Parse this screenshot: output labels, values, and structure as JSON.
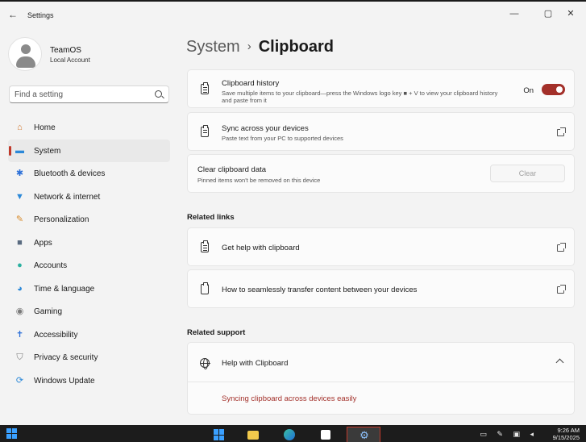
{
  "window": {
    "app_title": "Settings",
    "controls": {
      "minimize": "—",
      "maximize": "▢",
      "close": "✕"
    }
  },
  "profile": {
    "name": "TeamOS",
    "account_type": "Local Account"
  },
  "search": {
    "placeholder": "Find a setting"
  },
  "nav": {
    "items": [
      {
        "label": "Home",
        "icon": "home-icon",
        "glyph": "⌂",
        "color": "#d0762b",
        "active": false
      },
      {
        "label": "System",
        "icon": "system-icon",
        "glyph": "▬",
        "color": "#2b88d8",
        "active": true
      },
      {
        "label": "Bluetooth & devices",
        "icon": "bluetooth-icon",
        "glyph": "✱",
        "color": "#2b6fd8",
        "active": false
      },
      {
        "label": "Network & internet",
        "icon": "wifi-icon",
        "glyph": "▼",
        "color": "#2b88d8",
        "active": false
      },
      {
        "label": "Personalization",
        "icon": "brush-icon",
        "glyph": "✎",
        "color": "#d88a2b",
        "active": false
      },
      {
        "label": "Apps",
        "icon": "apps-icon",
        "glyph": "■",
        "color": "#5a6b80",
        "active": false
      },
      {
        "label": "Accounts",
        "icon": "accounts-icon",
        "glyph": "●",
        "color": "#2bb0a0",
        "active": false
      },
      {
        "label": "Time & language",
        "icon": "globe-clock-icon",
        "glyph": "◕",
        "color": "#2b88d8",
        "active": false
      },
      {
        "label": "Gaming",
        "icon": "gamepad-icon",
        "glyph": "◉",
        "color": "#7a7a7a",
        "active": false
      },
      {
        "label": "Accessibility",
        "icon": "accessibility-icon",
        "glyph": "✝",
        "color": "#2b6fd8",
        "active": false
      },
      {
        "label": "Privacy & security",
        "icon": "shield-icon",
        "glyph": "⛉",
        "color": "#7a7a7a",
        "active": false
      },
      {
        "label": "Windows Update",
        "icon": "update-icon",
        "glyph": "⟳",
        "color": "#2b88d8",
        "active": false
      }
    ]
  },
  "header": {
    "parent": "System",
    "separator": "›",
    "current": "Clipboard"
  },
  "clipboard_history": {
    "title": "Clipboard history",
    "description": "Save multiple items to your clipboard—press the Windows logo key ■ + V to view your clipboard history and paste from it",
    "state_label": "On",
    "enabled": true
  },
  "sync": {
    "title": "Sync across your devices",
    "description": "Paste text from your PC to supported devices"
  },
  "clear": {
    "title": "Clear clipboard data",
    "description": "Pinned items won't be removed on this device",
    "button_label": "Clear"
  },
  "related_links": {
    "heading": "Related links",
    "items": [
      {
        "label": "Get help with clipboard"
      },
      {
        "label": "How to seamlessly transfer content between your devices"
      }
    ]
  },
  "related_support": {
    "heading": "Related support",
    "title": "Help with Clipboard",
    "link": "Syncing clipboard across devices easily"
  },
  "taskbar": {
    "time": "9:26 AM",
    "date": "9/15/2025",
    "tray_glyphs": "▭ ✎ ▣ ◂"
  }
}
